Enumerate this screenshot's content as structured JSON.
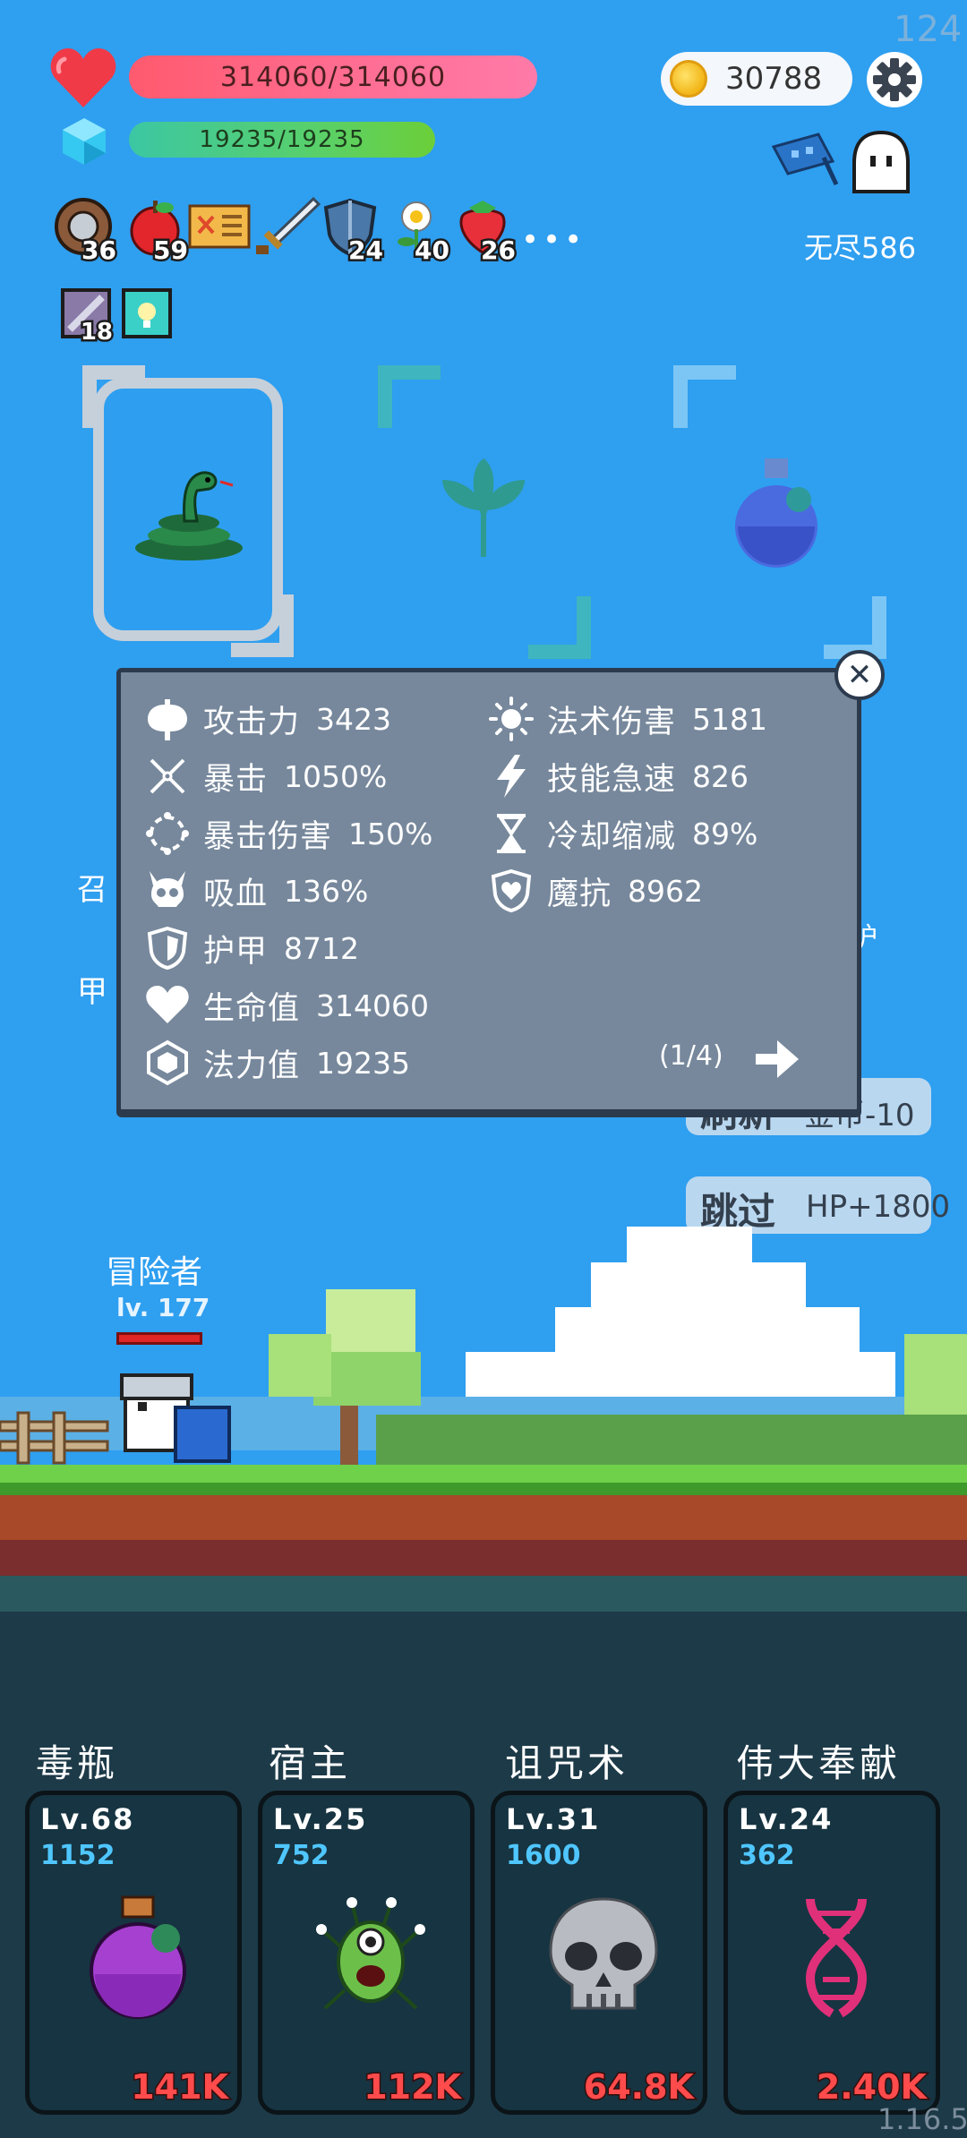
{
  "hud": {
    "fps": "124",
    "hp": "314060/314060",
    "mp": "19235/19235",
    "coins": "30788",
    "mode": "无尽586",
    "version": "1.16.5"
  },
  "items": [
    {
      "name": "round-shield",
      "count": "36"
    },
    {
      "name": "apple",
      "count": "59"
    },
    {
      "name": "scroll-map",
      "count": ""
    },
    {
      "name": "sword",
      "count": ""
    },
    {
      "name": "shield",
      "count": "24"
    },
    {
      "name": "flower",
      "count": "40"
    },
    {
      "name": "strawberry",
      "count": "26"
    }
  ],
  "more_label": "•••",
  "buffs": [
    {
      "name": "stone-blade-buff",
      "count": "18"
    },
    {
      "name": "light-buff",
      "count": ""
    }
  ],
  "stats": {
    "attack": {
      "label": "攻击力",
      "value": "3423"
    },
    "crit": {
      "label": "暴击",
      "value": "1050%"
    },
    "crit_damage": {
      "label": "暴击伤害",
      "value": "150%"
    },
    "lifesteal": {
      "label": "吸血",
      "value": "136%"
    },
    "armor": {
      "label": "护甲",
      "value": "8712"
    },
    "health": {
      "label": "生命值",
      "value": "314060"
    },
    "mana": {
      "label": "法力值",
      "value": "19235"
    },
    "spell_damage": {
      "label": "法术伤害",
      "value": "5181"
    },
    "skill_haste": {
      "label": "技能急速",
      "value": "826"
    },
    "cooldown": {
      "label": "冷却缩减",
      "value": "89%"
    },
    "magic_resist": {
      "label": "魔抗",
      "value": "8962"
    },
    "page": "(1/4)"
  },
  "fragments": {
    "left_1": "召",
    "left_2": "甲",
    "right_1": "护"
  },
  "buttons": {
    "refresh_main": "刷新",
    "refresh_sub": "金币-10",
    "skip_main": "跳过",
    "skip_sub": "HP+1800"
  },
  "hero": {
    "name": "冒险者",
    "level": "lv. 177"
  },
  "skills": [
    {
      "title": "毒瓶",
      "level": "Lv.68",
      "cost": "1152",
      "damage": "141K",
      "icon": "poison-bottle-icon"
    },
    {
      "title": "宿主",
      "level": "Lv.25",
      "cost": "752",
      "damage": "112K",
      "icon": "parasite-host-icon"
    },
    {
      "title": "诅咒术",
      "level": "Lv.31",
      "cost": "1600",
      "damage": "64.8K",
      "icon": "skull-icon"
    },
    {
      "title": "伟大奉献",
      "level": "Lv.24",
      "cost": "362",
      "damage": "2.40K",
      "icon": "dna-icon"
    }
  ],
  "colors": {
    "sky": "#2f9ff0",
    "hp_bar": "#ff6f95",
    "mp_bar": "#58d06b",
    "panel": "#77889c",
    "skill_cost": "#4fc6ff",
    "skill_damage": "#ff4b4b"
  }
}
